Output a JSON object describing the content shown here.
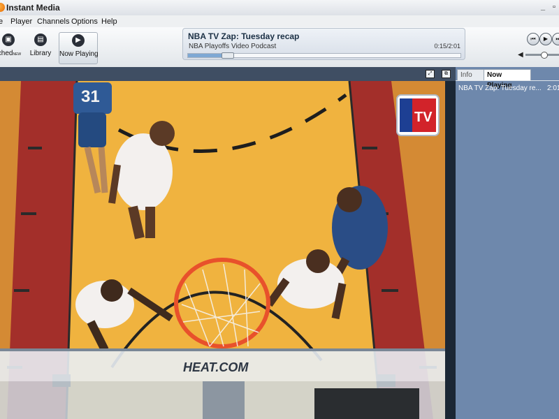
{
  "window": {
    "title": "Instant Media",
    "min_glyph": "_",
    "restore_glyph": "▫"
  },
  "menu": [
    "Player",
    "Channels",
    "Options",
    "Help"
  ],
  "menu_partial": "e",
  "toolbar": {
    "watched_label": "tched",
    "watched_badge": "NEW",
    "library_label": "Library",
    "now_playing_label": "Now Playing"
  },
  "now_playing": {
    "title": "NBA TV Zap: Tuesday recap",
    "subtitle": "NBA Playoffs Video Podcast",
    "time": "0:15/2:01",
    "progress": 0.124
  },
  "volume": {
    "level": 0.55
  },
  "video": {
    "logo_text": "TV",
    "sponsor_text": "HEAT.COM",
    "jersey_number": "31"
  },
  "side_panel": {
    "tabs": [
      "Info",
      "Now Playing"
    ],
    "active_tab": "Now Playing",
    "items": [
      {
        "title": "NBA TV Zap: Tuesday re...",
        "duration": "2:01"
      }
    ]
  }
}
